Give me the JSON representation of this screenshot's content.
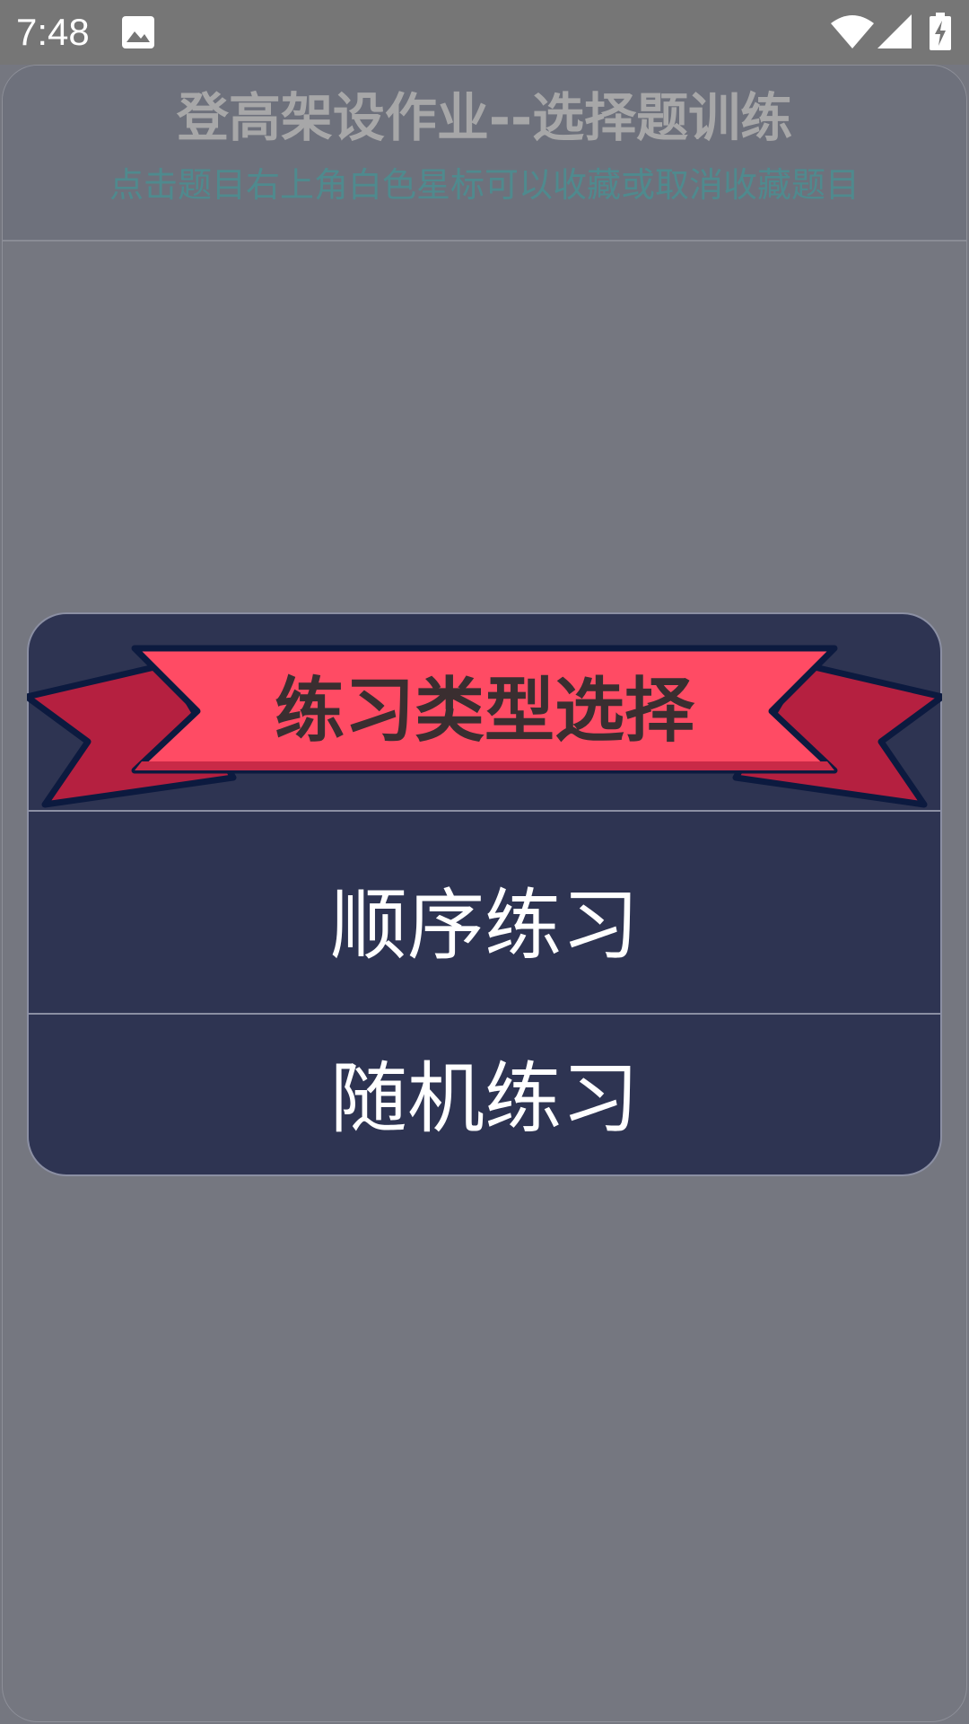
{
  "status_bar": {
    "time": "7:48",
    "icons": [
      "image-icon",
      "wifi-icon",
      "signal-icon",
      "battery-charging-icon"
    ]
  },
  "header": {
    "title": "登高架设作业--选择题训练",
    "subtitle": "点击题目右上角白色星标可以收藏或取消收藏题目"
  },
  "dialog": {
    "title": "练习类型选择",
    "options": [
      {
        "label": "顺序练习"
      },
      {
        "label": "随机练习"
      }
    ]
  },
  "colors": {
    "dialog_bg": "#2e3452",
    "ribbon_front": "#ff4b64",
    "ribbon_back": "#b52040",
    "ribbon_outline": "#0c1a3f",
    "subtitle": "#4f8a8e"
  }
}
